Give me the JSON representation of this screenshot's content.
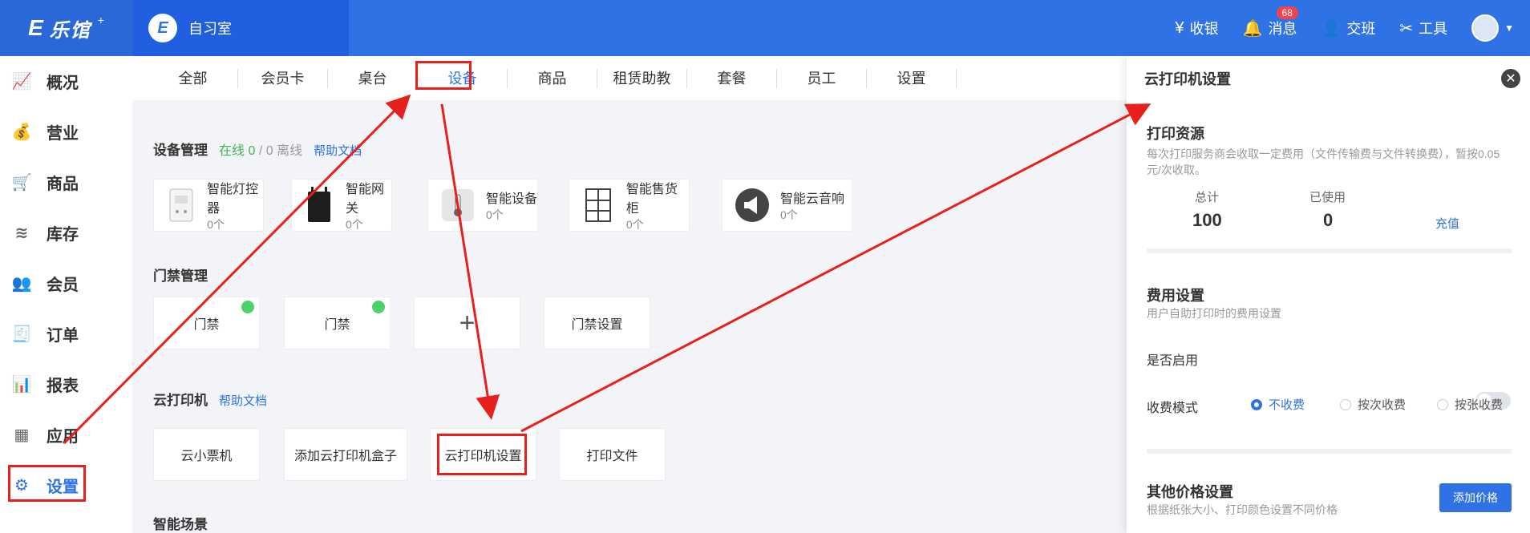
{
  "topbar": {
    "logo_mark": "E",
    "logo_text": "乐馆",
    "logo_star": "+",
    "store_initial": "E",
    "store_name": "自习室",
    "nav": [
      {
        "label": "收银",
        "icon": "cashier-icon",
        "glyph": "¥"
      },
      {
        "label": "消息",
        "icon": "bell-icon",
        "glyph": "🔔",
        "badge": "68"
      },
      {
        "label": "交班",
        "icon": "user-switch-icon",
        "glyph": "👤"
      },
      {
        "label": "工具",
        "icon": "tools-icon",
        "glyph": "✂"
      }
    ],
    "caret": "▼"
  },
  "sidebar": {
    "items": [
      {
        "label": "概况",
        "icon": "chart-icon",
        "glyph": "📈"
      },
      {
        "label": "营业",
        "icon": "money-bag-icon",
        "glyph": "💰"
      },
      {
        "label": "商品",
        "icon": "cart-icon",
        "glyph": "🛒"
      },
      {
        "label": "库存",
        "icon": "layers-icon",
        "glyph": "≋"
      },
      {
        "label": "会员",
        "icon": "member-icon",
        "glyph": "👥"
      },
      {
        "label": "订单",
        "icon": "order-icon",
        "glyph": "🧾"
      },
      {
        "label": "报表",
        "icon": "report-icon",
        "glyph": "📊"
      },
      {
        "label": "应用",
        "icon": "apps-icon",
        "glyph": "▦"
      },
      {
        "label": "设置",
        "icon": "gear-icon",
        "glyph": "⚙",
        "active": true
      }
    ]
  },
  "tabs": [
    "全部",
    "会员卡",
    "桌台",
    "设备",
    "商品",
    "租赁助教",
    "套餐",
    "员工",
    "设置"
  ],
  "active_tab": "设备",
  "device_section": {
    "title": "设备管理",
    "online_label": "在线",
    "online_count": "0",
    "separator": "/",
    "offline_count": "0",
    "offline_label": "离线",
    "help": "帮助文档",
    "devices": [
      {
        "name": "智能灯控器",
        "count": "0个",
        "icon": "light-controller-icon"
      },
      {
        "name": "智能网关",
        "count": "0个",
        "icon": "gateway-icon"
      },
      {
        "name": "智能设备",
        "count": "0个",
        "icon": "thermometer-icon"
      },
      {
        "name": "智能售货柜",
        "count": "0个",
        "icon": "vending-cabinet-icon"
      },
      {
        "name": "智能云音响",
        "count": "0个",
        "icon": "speaker-icon"
      }
    ]
  },
  "access_section": {
    "title": "门禁管理",
    "cards": [
      "门禁",
      "门禁",
      "+",
      "门禁设置"
    ]
  },
  "printer_section": {
    "title": "云打印机",
    "help": "帮助文档",
    "cards": [
      "云小票机",
      "添加云打印机盒子",
      "云打印机设置",
      "打印文件"
    ]
  },
  "scene_section": {
    "title": "智能场景"
  },
  "panel": {
    "title": "云打印机设置",
    "close": "✕",
    "resource": {
      "title": "打印资源",
      "desc": "每次打印服务商会收取一定费用（文件传输费与文件转换费），暂按0.05元/次收取。",
      "total_label": "总计",
      "total_value": "100",
      "used_label": "已使用",
      "used_value": "0",
      "recharge": "充值"
    },
    "fee": {
      "title": "费用设置",
      "desc": "用户自助打印时的费用设置",
      "enable_label": "是否启用",
      "enabled": false,
      "mode_label": "收费模式",
      "modes": [
        "不收费",
        "按次收费",
        "按张收费"
      ],
      "selected_mode": "不收费"
    },
    "other": {
      "title": "其他价格设置",
      "desc": "根据纸张大小、打印颜色设置不同价格",
      "add_button": "添加价格"
    }
  }
}
